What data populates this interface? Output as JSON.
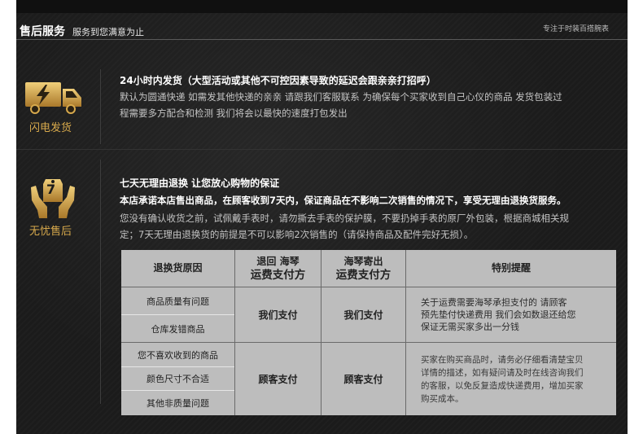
{
  "header": {
    "title": "售后服务",
    "subtitle": "服务到您满意为止",
    "tagline": "专注于时装百搭腕表"
  },
  "section1": {
    "icon_name": "delivery-truck-icon",
    "icon_label": "闪电发货",
    "heading": "24小时内发货（大型活动或其他不可控因素导致的延迟会跟亲亲打招呼）",
    "line1": "默认为圆通快递 如需发其他快递的亲亲 请跟我们客服联系 为确保每个买家收到自己心仪的商品 发货包装过",
    "line2": "程需要多方配合和检测 我们将会以最快的速度打包发出"
  },
  "section2": {
    "icon_name": "hands-tag-icon",
    "icon_badge": "7",
    "icon_label": "无忧售后",
    "heading": "七天无理由退换   让您放心购物的保证",
    "line1": "本店承诺本店售出商品，在顾客收到7天内，保证商品在不影响二次销售的情况下，享受无理由退换货服务。",
    "line2": "您没有确认收货之前，试佩戴手表时，请勿撕去手表的保护膜，不要扔掉手表的原厂外包装，根据商城相关规",
    "line3": "定；7天无理由退换货的前提是不可以影响2次销售的（请保持商品及配件完好无损）。"
  },
  "table": {
    "headers": {
      "reason": "退换货原因",
      "col2_top": "退回 海琴",
      "col2_bottom": "运费支付方",
      "col3_top": "海琴寄出",
      "col3_bottom": "运费支付方",
      "note": "特别提醒"
    },
    "group1": {
      "reasons": [
        "商品质量有问题",
        "仓库发错商品"
      ],
      "return_payer": "我们支付",
      "send_payer": "我们支付",
      "note_lines": [
        "关于运费需要海琴承担支付的 请顾客",
        "预先垫付快递费用 我们会如数退还给您",
        "保证无需买家多出一分钱"
      ]
    },
    "group2": {
      "reasons": [
        "您不喜欢收到的商品",
        "颜色尺寸不合适",
        "其他非质量问题"
      ],
      "return_payer": "顾客支付",
      "send_payer": "顾客支付",
      "note_lines": [
        "买家在购买商品时，请务必仔细看清楚宝贝",
        "详情的描述，如有疑问请及时在线咨询我们",
        "的客服，以免反复造成快递费用，增加买家",
        "购买成本。"
      ]
    }
  },
  "colors": {
    "background": "#1b1b1b",
    "accent_gold": "#d7a94c",
    "table_bg": "#bdbdbd"
  }
}
